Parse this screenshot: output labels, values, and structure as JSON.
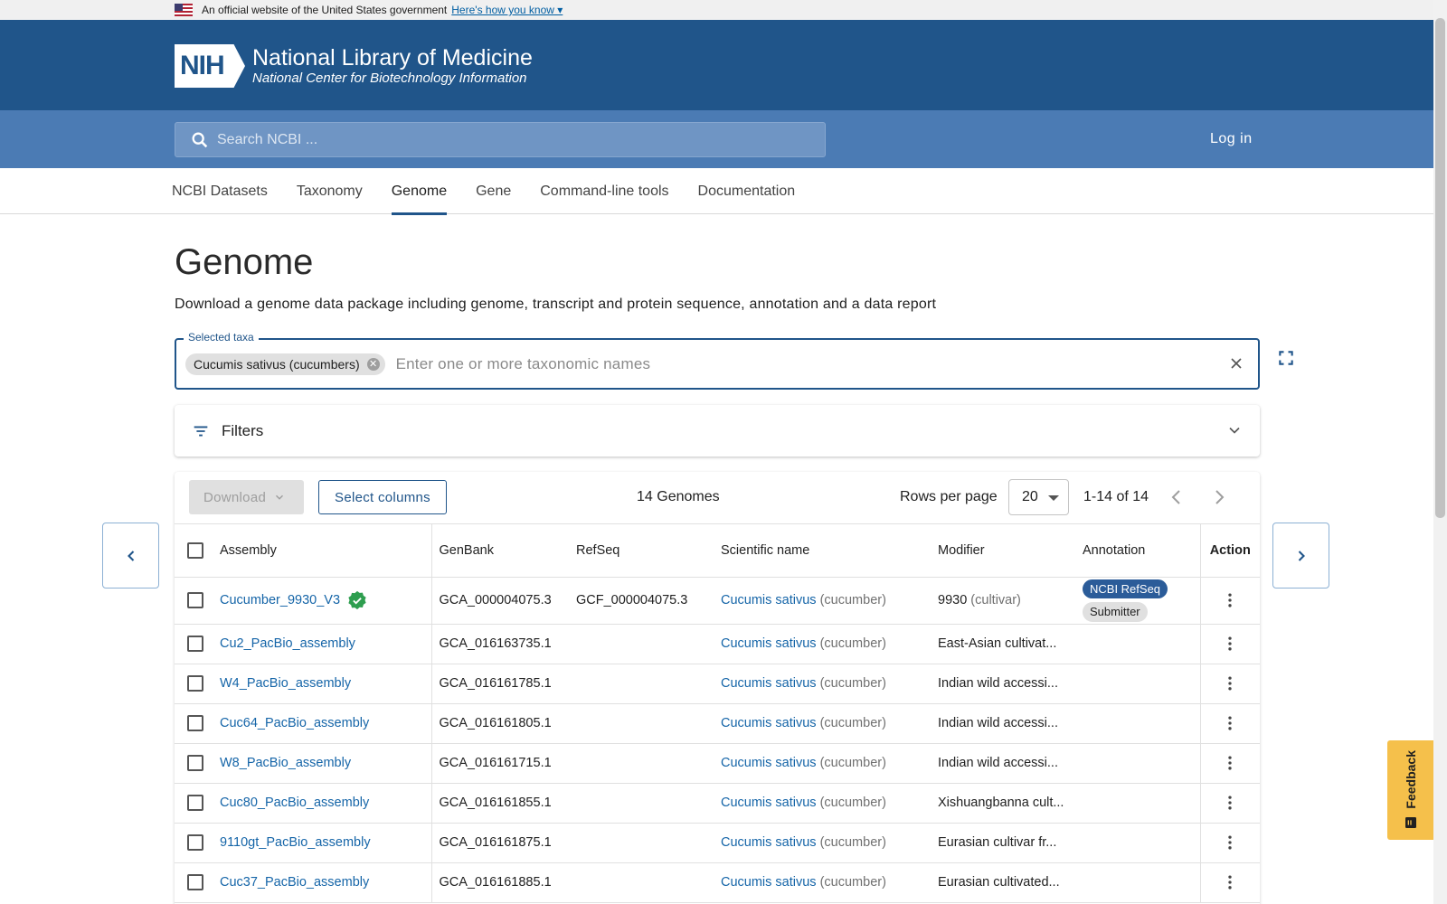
{
  "gov_banner": {
    "text": "An official website of the United States government",
    "link": "Here's how you know"
  },
  "header": {
    "line1": "National Library of Medicine",
    "line2": "National Center for Biotechnology Information",
    "logo_text": "NIH"
  },
  "search": {
    "placeholder": "Search NCBI ...",
    "login_label": "Log in"
  },
  "tabs": [
    "NCBI Datasets",
    "Taxonomy",
    "Genome",
    "Gene",
    "Command-line tools",
    "Documentation"
  ],
  "active_tab": "Genome",
  "page": {
    "title": "Genome",
    "subtitle": "Download a genome data package including genome, transcript and protein sequence, annotation and a data report"
  },
  "taxa": {
    "legend": "Selected taxa",
    "chip": "Cucumis sativus (cucumbers)",
    "placeholder": "Enter one or more taxonomic names"
  },
  "filters": {
    "label": "Filters"
  },
  "toolbar": {
    "download_label": "Download",
    "select_columns_label": "Select columns",
    "count": "14 Genomes",
    "rows_per_page_label": "Rows per page",
    "rows_per_page_value": "20",
    "range": "1-14 of 14"
  },
  "table": {
    "columns": [
      "Assembly",
      "GenBank",
      "RefSeq",
      "Scientific name",
      "Modifier",
      "Annotation",
      "Action"
    ],
    "rows": [
      {
        "assembly": "Cucumber_9930_V3",
        "verified": true,
        "genbank": "GCA_000004075.3",
        "refseq": "GCF_000004075.3",
        "sci": "Cucumis sativus",
        "common": "(cucumber)",
        "modifier": "9930",
        "modifier_extra": "(cultivar)",
        "annotation": [
          "NCBI RefSeq",
          "Submitter"
        ]
      },
      {
        "assembly": "Cu2_PacBio_assembly",
        "verified": false,
        "genbank": "GCA_016163735.1",
        "refseq": "",
        "sci": "Cucumis sativus",
        "common": "(cucumber)",
        "modifier": "East-Asian cultivat...",
        "modifier_extra": "",
        "annotation": []
      },
      {
        "assembly": "W4_PacBio_assembly",
        "verified": false,
        "genbank": "GCA_016161785.1",
        "refseq": "",
        "sci": "Cucumis sativus",
        "common": "(cucumber)",
        "modifier": "Indian wild accessi...",
        "modifier_extra": "",
        "annotation": []
      },
      {
        "assembly": "Cuc64_PacBio_assembly",
        "verified": false,
        "genbank": "GCA_016161805.1",
        "refseq": "",
        "sci": "Cucumis sativus",
        "common": "(cucumber)",
        "modifier": "Indian wild accessi...",
        "modifier_extra": "",
        "annotation": []
      },
      {
        "assembly": "W8_PacBio_assembly",
        "verified": false,
        "genbank": "GCA_016161715.1",
        "refseq": "",
        "sci": "Cucumis sativus",
        "common": "(cucumber)",
        "modifier": "Indian wild accessi...",
        "modifier_extra": "",
        "annotation": []
      },
      {
        "assembly": "Cuc80_PacBio_assembly",
        "verified": false,
        "genbank": "GCA_016161855.1",
        "refseq": "",
        "sci": "Cucumis sativus",
        "common": "(cucumber)",
        "modifier": "Xishuangbanna cult...",
        "modifier_extra": "",
        "annotation": []
      },
      {
        "assembly": "9110gt_PacBio_assembly",
        "verified": false,
        "genbank": "GCA_016161875.1",
        "refseq": "",
        "sci": "Cucumis sativus",
        "common": "(cucumber)",
        "modifier": "Eurasian cultivar fr...",
        "modifier_extra": "",
        "annotation": []
      },
      {
        "assembly": "Cuc37_PacBio_assembly",
        "verified": false,
        "genbank": "GCA_016161885.1",
        "refseq": "",
        "sci": "Cucumis sativus",
        "common": "(cucumber)",
        "modifier": "Eurasian cultivated...",
        "modifier_extra": "",
        "annotation": []
      }
    ]
  },
  "feedback": {
    "label": "Feedback"
  },
  "colors": {
    "header_blue": "#20558a",
    "search_blue": "#4b7bb4",
    "link": "#1565a8",
    "feedback": "#f5c04b",
    "verified_green": "#2e9e4f"
  },
  "icons": [
    "us-flag-icon",
    "search-icon",
    "cancel-icon",
    "close-icon",
    "fullscreen-icon",
    "filter-icon",
    "chevron-down-icon",
    "chevron-left-icon",
    "chevron-right-icon",
    "verified-icon",
    "more-vert-icon",
    "feedback-icon"
  ]
}
